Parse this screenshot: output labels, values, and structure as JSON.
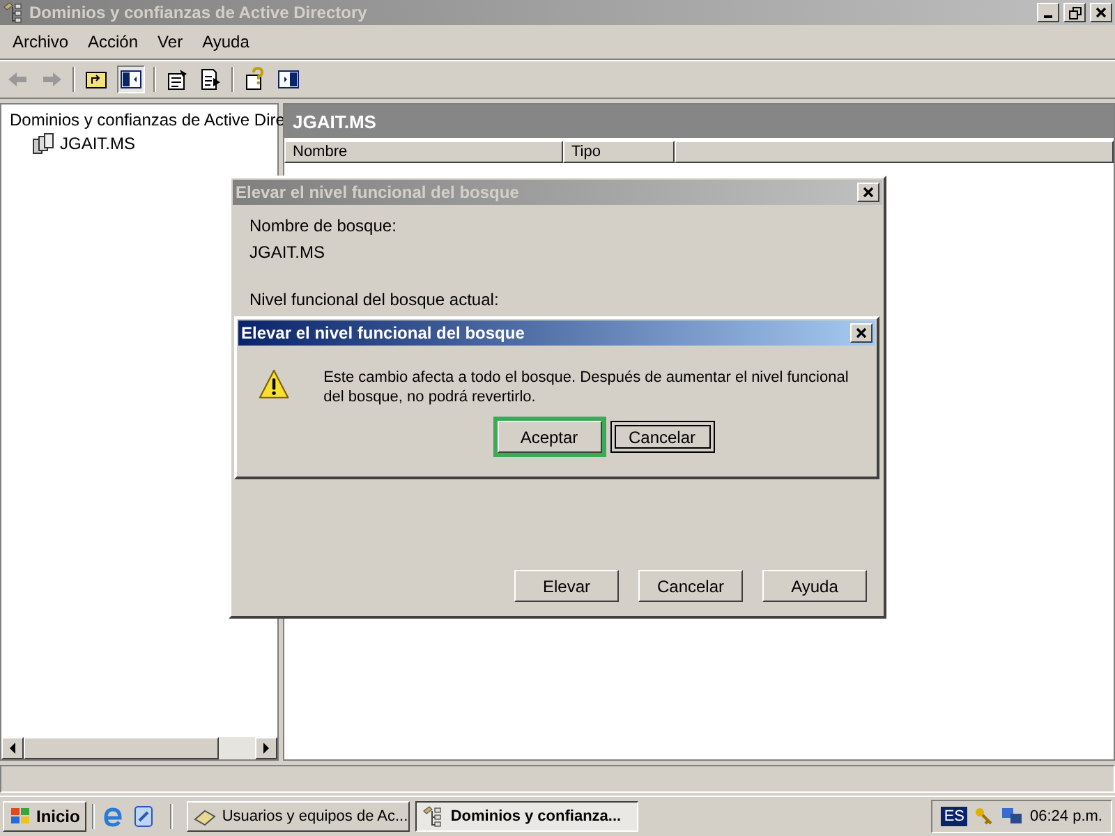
{
  "window": {
    "title": "Dominios y confianzas de Active Directory",
    "active": false
  },
  "menu": [
    {
      "label": "Archivo"
    },
    {
      "label": "Acción"
    },
    {
      "label": "Ver"
    },
    {
      "label": "Ayuda"
    }
  ],
  "tree": [
    {
      "label": "Dominios y confianzas de Active Dire",
      "children": [
        {
          "label": "JGAIT.MS"
        }
      ]
    }
  ],
  "pane": {
    "title": "JGAIT.MS",
    "columns": [
      "Nombre",
      "Tipo"
    ]
  },
  "dialog": {
    "title": "Elevar el nivel funcional del bosque",
    "active": false,
    "fields": [
      {
        "label": "Nombre de bosque:",
        "value": "JGAIT.MS"
      },
      {
        "label": "Nivel funcional del bosque actual:"
      }
    ],
    "buttons": [
      "Elevar",
      "Cancelar",
      "Ayuda"
    ]
  },
  "alert": {
    "title": "Elevar el nivel funcional del bosque",
    "active": true,
    "message": "Este cambio afecta a todo el bosque. Después de aumentar el nivel funcional del bosque, no podrá revertirlo.",
    "buttons": [
      {
        "label": "Aceptar",
        "highlighted": true,
        "focused": false
      },
      {
        "label": "Cancelar",
        "highlighted": false,
        "focused": true
      }
    ]
  },
  "taskbar": {
    "start": "Inicio",
    "tasks": [
      {
        "label": "Usuarios y equipos de Ac...",
        "selected": false
      },
      {
        "label": "Dominios y confianza...",
        "selected": true
      }
    ],
    "language": "ES",
    "clock": "06:24 p.m."
  }
}
